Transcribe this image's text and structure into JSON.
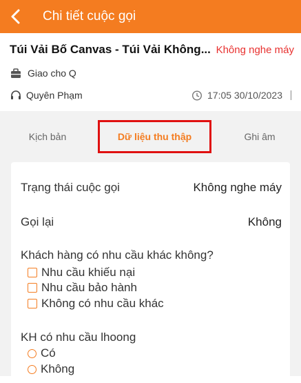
{
  "header": {
    "title": "Chi tiết cuộc gọi"
  },
  "info": {
    "product_name": "Túi Vải Bố Canvas - Túi Vải Không...",
    "call_status": "Không nghe máy",
    "assignee": "Giao cho Q",
    "agent": "Quyên Phạm",
    "time": "17:05 30/10/2023"
  },
  "tabs": [
    {
      "label": "Kịch bản"
    },
    {
      "label": "Dữ liệu thu thập"
    },
    {
      "label": "Ghi âm"
    }
  ],
  "fields": {
    "call_state": {
      "label": "Trạng thái cuộc gọi",
      "value": "Không nghe máy"
    },
    "callback": {
      "label": "Gọi lại",
      "value": "Không"
    }
  },
  "q1": {
    "title": "Khách hàng có nhu cầu khác không?",
    "options": [
      "Nhu cầu khiếu nại",
      "Nhu cầu bảo hành",
      "Không có nhu cầu khác"
    ]
  },
  "q2": {
    "title": "KH có nhu cầu lhoong",
    "options": [
      "Có",
      "Không"
    ]
  },
  "colors": {
    "accent": "#f47c20",
    "status_red": "#e8312f",
    "highlight_box": "#e01010"
  }
}
